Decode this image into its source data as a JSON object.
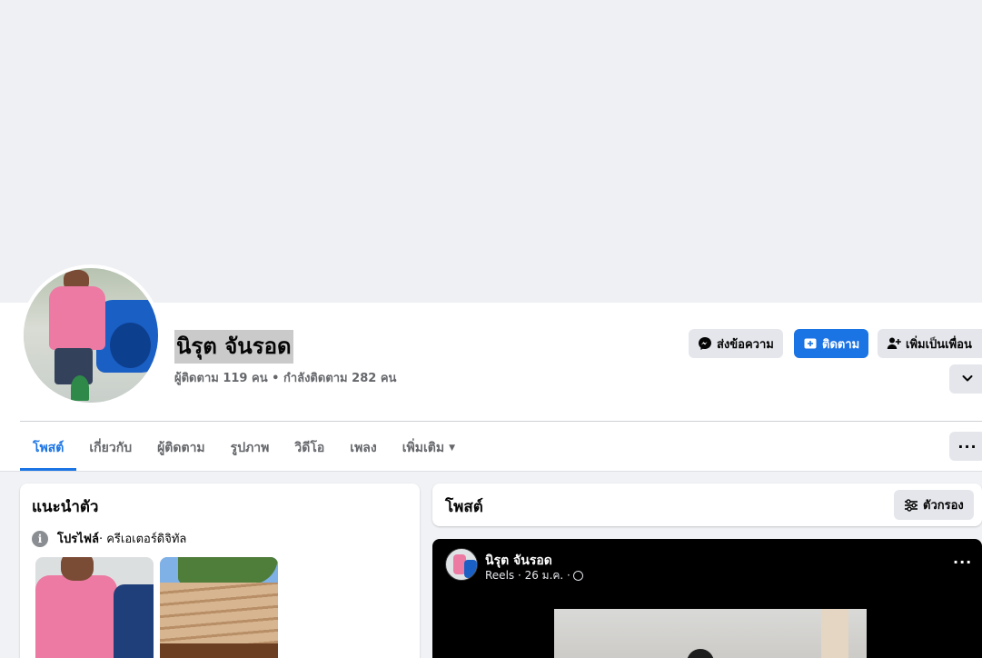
{
  "profile": {
    "name": "นิรุต จันรอด",
    "stats": "ผู้ติดตาม 119 คน • กำลังติดตาม 282 คน"
  },
  "actions": {
    "message_label": "ส่งข้อความ",
    "follow_label": "ติดตาม",
    "add_friend_label": "เพิ่มเป็นเพื่อน",
    "more_icon": "chevron-down-icon"
  },
  "tabs": [
    {
      "label": "โพสต์",
      "active": true
    },
    {
      "label": "เกี่ยวกับ",
      "active": false
    },
    {
      "label": "ผู้ติดตาม",
      "active": false
    },
    {
      "label": "รูปภาพ",
      "active": false
    },
    {
      "label": "วิดีโอ",
      "active": false
    },
    {
      "label": "เพลง",
      "active": false
    },
    {
      "label": "เพิ่มเติม",
      "active": false
    }
  ],
  "tab_overflow_label": "···",
  "intro": {
    "title": "แนะนำตัว",
    "profile_type_bold": "โปรไฟล์",
    "profile_type_rest": " · ครีเอเตอร์ดิจิทัล"
  },
  "posts": {
    "title": "โพสต์",
    "filter_label": "ตัวกรอง"
  },
  "reel_post": {
    "author": "นิรุต จันรอด",
    "meta": "Reels · 26 ม.ค. ·",
    "menu_label": "···"
  },
  "colors": {
    "accent": "#1b74e4",
    "button_gray": "#e4e6eb",
    "page_bg": "#f0f2f5"
  }
}
